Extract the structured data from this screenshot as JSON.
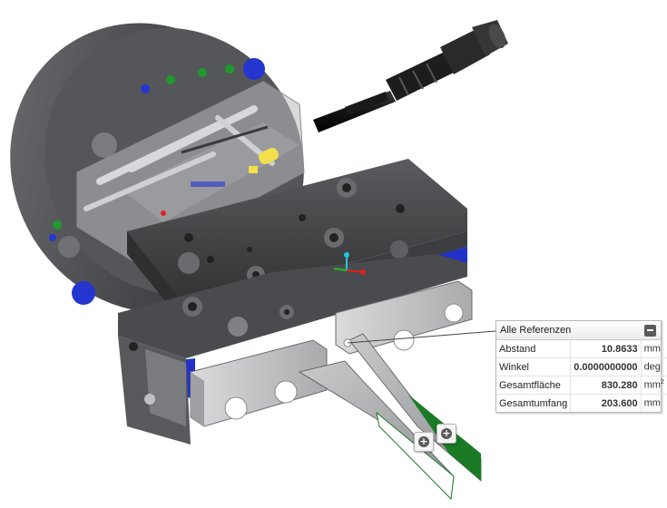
{
  "measure_panel": {
    "title": "Alle Referenzen",
    "collapse_icon": "minus-icon",
    "rows": [
      {
        "label": "Abstand",
        "value": "10.8633",
        "unit": "mm",
        "unit_sup": ""
      },
      {
        "label": "Winkel",
        "value": "0.0000000000",
        "unit": "deg",
        "unit_sup": ""
      },
      {
        "label": "Gesamtfläche",
        "value": "830.280",
        "unit": "mm",
        "unit_sup": "2"
      },
      {
        "label": "Gesamtumfang",
        "value": "203.600",
        "unit": "mm",
        "unit_sup": ""
      }
    ]
  },
  "viewport_buttons": [
    {
      "name": "add-measure-button-1",
      "icon": "plus-icon",
      "glyph": "+"
    },
    {
      "name": "add-measure-button-2",
      "icon": "plus-icon",
      "glyph": "+"
    }
  ],
  "colors": {
    "body_dark": "#3c3d40",
    "body_mid": "#8a8b8e",
    "body_light": "#cfd0d2",
    "blue_accent": "#2232c8",
    "green_accent": "#1a7a26",
    "yellow_accent": "#f2e04a",
    "triad_red": "#e02020",
    "triad_green": "#20c020",
    "triad_cyan": "#20c8e0"
  }
}
